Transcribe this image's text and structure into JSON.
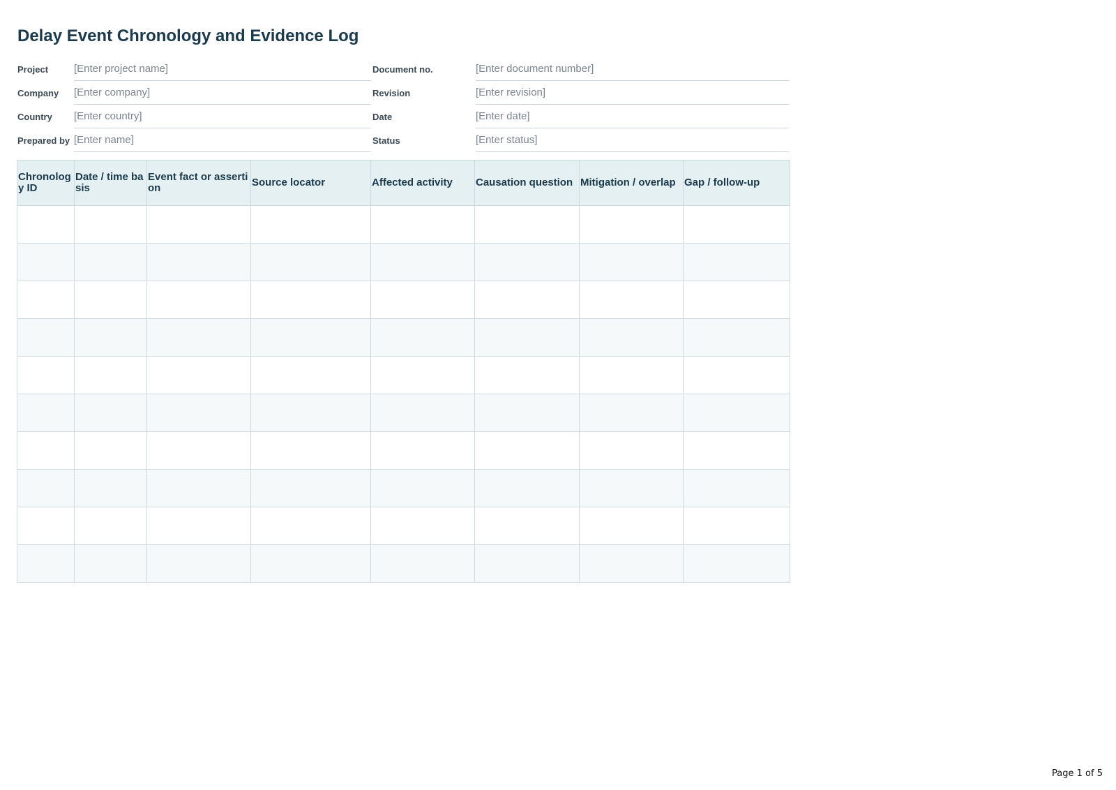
{
  "document": {
    "title": "Delay Event Chronology and Evidence Log"
  },
  "meta_fields": [
    {
      "left_label": "Project",
      "left_value": "[Enter project name]",
      "right_label": "Document no.",
      "right_value": "[Enter document number]"
    },
    {
      "left_label": "Company",
      "left_value": "[Enter company]",
      "right_label": "Revision",
      "right_value": "[Enter revision]"
    },
    {
      "left_label": "Country",
      "left_value": "[Enter country]",
      "right_label": "Date",
      "right_value": "[Enter date]"
    },
    {
      "left_label": "Prepared by",
      "left_value": "[Enter name]",
      "right_label": "Status",
      "right_value": "[Enter status]"
    }
  ],
  "table": {
    "columns": [
      "Chronology ID",
      "Date / time basis",
      "Event fact or assertion",
      "Source locator",
      "Affected activity",
      "Causation question",
      "Mitigation / overlap",
      "Gap / follow-up"
    ],
    "empty_rows": 10
  },
  "footer": {
    "page_label": "Page 1 of 5"
  }
}
